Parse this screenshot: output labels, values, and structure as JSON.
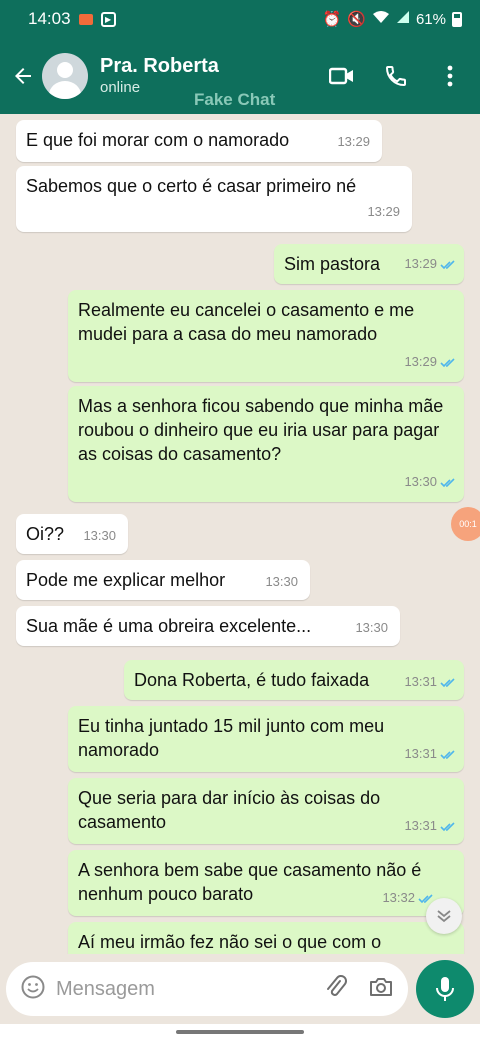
{
  "status_bar": {
    "time": "14:03",
    "battery": "61%"
  },
  "header": {
    "contact_name": "Pra. Roberta",
    "contact_status": "online",
    "watermark": "Fake Chat"
  },
  "messages": [
    {
      "dir": "in",
      "text": "E que foi morar com o namorado",
      "time": "13:29"
    },
    {
      "dir": "in",
      "text": "Sabemos que o certo é casar primeiro né",
      "time": "13:29"
    },
    {
      "dir": "out",
      "text": "Sim pastora",
      "time": "13:29"
    },
    {
      "dir": "out",
      "text": "Realmente eu cancelei o casamento e me mudei para a casa do meu namorado",
      "time": "13:29"
    },
    {
      "dir": "out",
      "text": "Mas a senhora ficou sabendo que minha mãe roubou o dinheiro que eu iria usar para pagar as coisas do casamento?",
      "time": "13:30"
    },
    {
      "dir": "in",
      "text": "Oi??",
      "time": "13:30"
    },
    {
      "dir": "in",
      "text": "Pode me explicar melhor",
      "time": "13:30"
    },
    {
      "dir": "in",
      "text": "Sua mãe é uma obreira excelente...",
      "time": "13:30"
    },
    {
      "dir": "out",
      "text": "Dona Roberta, é tudo faixada",
      "time": "13:31"
    },
    {
      "dir": "out",
      "text": "Eu tinha juntado 15 mil junto com meu namorado",
      "time": "13:31"
    },
    {
      "dir": "out",
      "text": "Que seria para dar início às coisas do casamento",
      "time": "13:31"
    },
    {
      "dir": "out",
      "text": "A senhora bem sabe que casamento não é nenhum pouco barato",
      "time": "13:32"
    },
    {
      "dir": "out",
      "text": "Aí meu irmão fez não sei o que com o",
      "time": ""
    }
  ],
  "floating_badge": "00:1",
  "composer": {
    "placeholder": "Mensagem"
  },
  "colors": {
    "header": "#0e6f5c",
    "chat_bg": "#ece5dd",
    "incoming": "#ffffff",
    "outgoing": "#dcf8c6",
    "read_check": "#4fb6ec",
    "mic": "#0e8a6d"
  },
  "icons": {
    "back": "arrow-left-icon",
    "video": "video-call-icon",
    "call": "phone-icon",
    "menu": "more-vert-icon",
    "emoji": "emoji-icon",
    "attach": "paperclip-icon",
    "camera": "camera-icon",
    "mic": "mic-icon",
    "scroll": "chevron-double-down-icon"
  }
}
